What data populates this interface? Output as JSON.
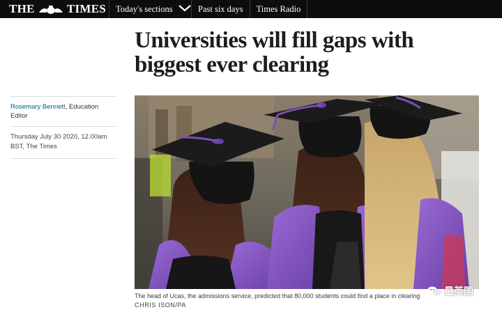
{
  "nav": {
    "logo_left": "THE",
    "logo_right": "TIMES",
    "items": [
      {
        "label": "Today's sections"
      },
      {
        "label": "Past six days"
      },
      {
        "label": "Times Radio"
      }
    ]
  },
  "article": {
    "headline": "Universities will fill gaps with biggest ever clearing",
    "author": "Rosemary Bennett",
    "author_role": ", Education Editor",
    "date": "Thursday July 30 2020, 12.00am BST, The Times",
    "caption": "The head of Ucas, the admissions service, predicted that 80,000 students could find a place in clearing",
    "credit": "CHRIS ISON/PA"
  },
  "watermark": {
    "text": "最英国"
  },
  "colors": {
    "topbar": "#0d0d0d",
    "author_link": "#005b8f",
    "gown_purple": "#7b4fb8"
  }
}
